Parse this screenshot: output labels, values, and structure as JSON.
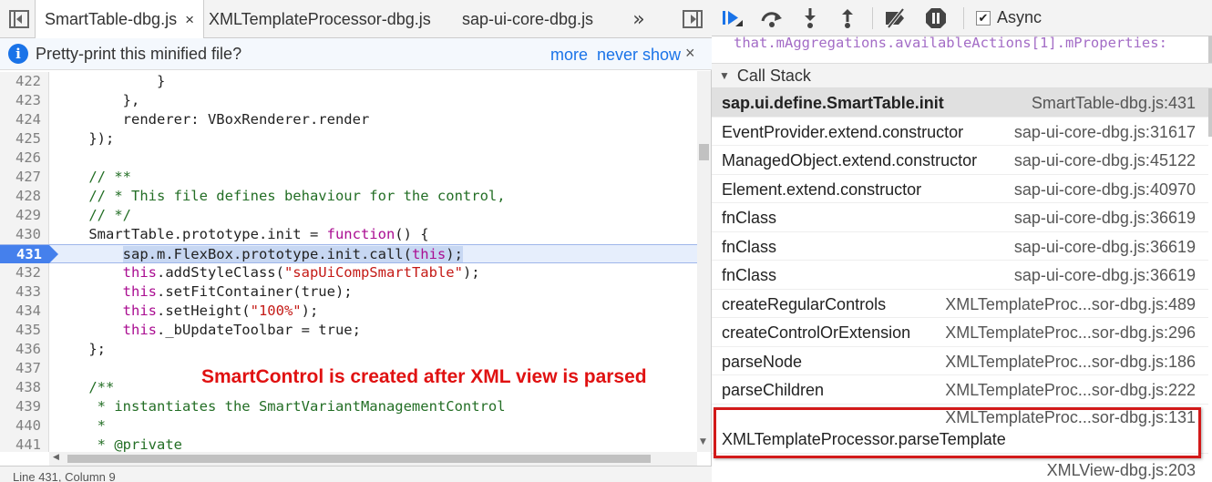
{
  "tabs": [
    {
      "label": "SmartTable-dbg.js",
      "close": "×"
    },
    {
      "label": "XMLTemplateProcessor-dbg.js"
    },
    {
      "label": "sap-ui-core-dbg.js"
    }
  ],
  "tab_overflow": "»",
  "infobar": {
    "message": "Pretty-print this minified file?",
    "more": "more",
    "never_show": "never show",
    "close": "×",
    "icon": "i"
  },
  "code_lines": [
    {
      "n": "422",
      "t": "            }"
    },
    {
      "n": "423",
      "t": "        },"
    },
    {
      "n": "424",
      "t": "        renderer: VBoxRenderer.render"
    },
    {
      "n": "425",
      "t": "    });"
    },
    {
      "n": "426",
      "t": ""
    },
    {
      "n": "427",
      "t": "    // **"
    },
    {
      "n": "428",
      "t": "    // * This file defines behaviour for the control,"
    },
    {
      "n": "429",
      "t": "    // */"
    },
    {
      "n": "430",
      "t": "    SmartTable.prototype.init = function() {"
    },
    {
      "n": "431",
      "t": "        sap.m.FlexBox.prototype.init.call(this);"
    },
    {
      "n": "432",
      "t": "        this.addStyleClass(\"sapUiCompSmartTable\");"
    },
    {
      "n": "433",
      "t": "        this.setFitContainer(true);"
    },
    {
      "n": "434",
      "t": "        this.setHeight(\"100%\");"
    },
    {
      "n": "435",
      "t": "        this._bUpdateToolbar = true;"
    },
    {
      "n": "436",
      "t": "    };"
    },
    {
      "n": "437",
      "t": ""
    },
    {
      "n": "438",
      "t": "    /**"
    },
    {
      "n": "439",
      "t": "     * instantiates the SmartVariantManagementControl"
    },
    {
      "n": "440",
      "t": "     *"
    },
    {
      "n": "441",
      "t": "     * @private"
    }
  ],
  "status_text": "Line 431, Column 9",
  "annotation": "SmartControl is created after XML view is parsed",
  "debugger": {
    "async_label": "Async",
    "async_checked": true,
    "watch_expression": "that.mAggregations.availableActions[1].mProperties:"
  },
  "call_stack": {
    "header": "Call Stack",
    "frames": [
      {
        "fn": "sap.ui.define.SmartTable.init",
        "loc": "SmartTable-dbg.js:431",
        "selected": true
      },
      {
        "fn": "EventProvider.extend.constructor",
        "loc": "sap-ui-core-dbg.js:31617"
      },
      {
        "fn": "ManagedObject.extend.constructor",
        "loc": "sap-ui-core-dbg.js:45122"
      },
      {
        "fn": "Element.extend.constructor",
        "loc": "sap-ui-core-dbg.js:40970"
      },
      {
        "fn": "fnClass",
        "loc": "sap-ui-core-dbg.js:36619"
      },
      {
        "fn": "fnClass",
        "loc": "sap-ui-core-dbg.js:36619"
      },
      {
        "fn": "fnClass",
        "loc": "sap-ui-core-dbg.js:36619"
      },
      {
        "fn": "createRegularControls",
        "loc": "XMLTemplateProc...sor-dbg.js:489"
      },
      {
        "fn": "createControlOrExtension",
        "loc": "XMLTemplateProc...sor-dbg.js:296"
      },
      {
        "fn": "parseNode",
        "loc": "XMLTemplateProc...sor-dbg.js:186"
      },
      {
        "fn": "parseChildren",
        "loc": "XMLTemplateProc...sor-dbg.js:222"
      },
      {
        "fn": "XMLTemplateProcessor.parseTemplate",
        "loc": "XMLTemplateProc...sor-dbg.js:131"
      }
    ],
    "partial_frame_loc": "XMLView-dbg.js:203"
  },
  "colors": {
    "accent": "#1a73e8",
    "exec_line": "#4580ec",
    "annotation": "#e01111",
    "keyword": "#aa0d91",
    "string": "#c41a16",
    "comment": "#236e25"
  }
}
